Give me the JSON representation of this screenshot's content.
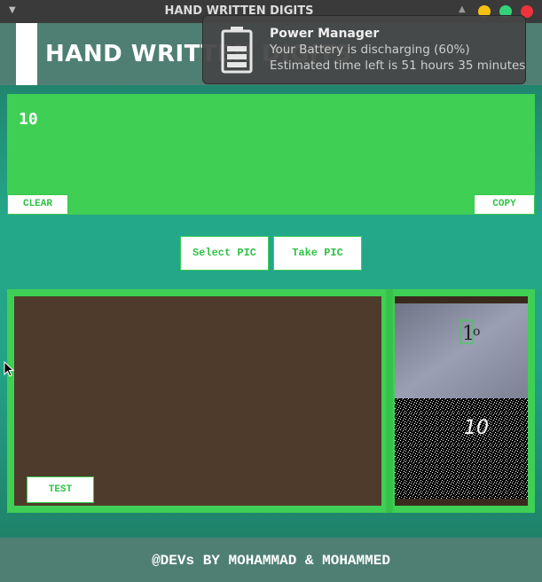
{
  "window": {
    "title": "HAND WRITTEN DIGITS"
  },
  "header": {
    "title": "HAND WRITTEN DIGITS"
  },
  "notification": {
    "title": "Power Manager",
    "line1": "Your Battery is discharging (60%)",
    "line2": "Estimated time left is 51 hours 35 minutes",
    "icon": "battery-icon"
  },
  "result": {
    "value": "10",
    "clear_label": "CLEAR",
    "copy_label": "COPY"
  },
  "actions": {
    "select_label": "Select PIC",
    "take_label": "Take PIC"
  },
  "panel": {
    "test_label": "TEST",
    "preview_digits": "10"
  },
  "footer": {
    "text": "@DEVs BY MOHAMMAD & MOHAMMED"
  },
  "colors": {
    "accent": "#3fcf55",
    "header_bg": "#4f7f73",
    "canvas_bg": "#4f3b2b",
    "background": "#24a88a"
  }
}
